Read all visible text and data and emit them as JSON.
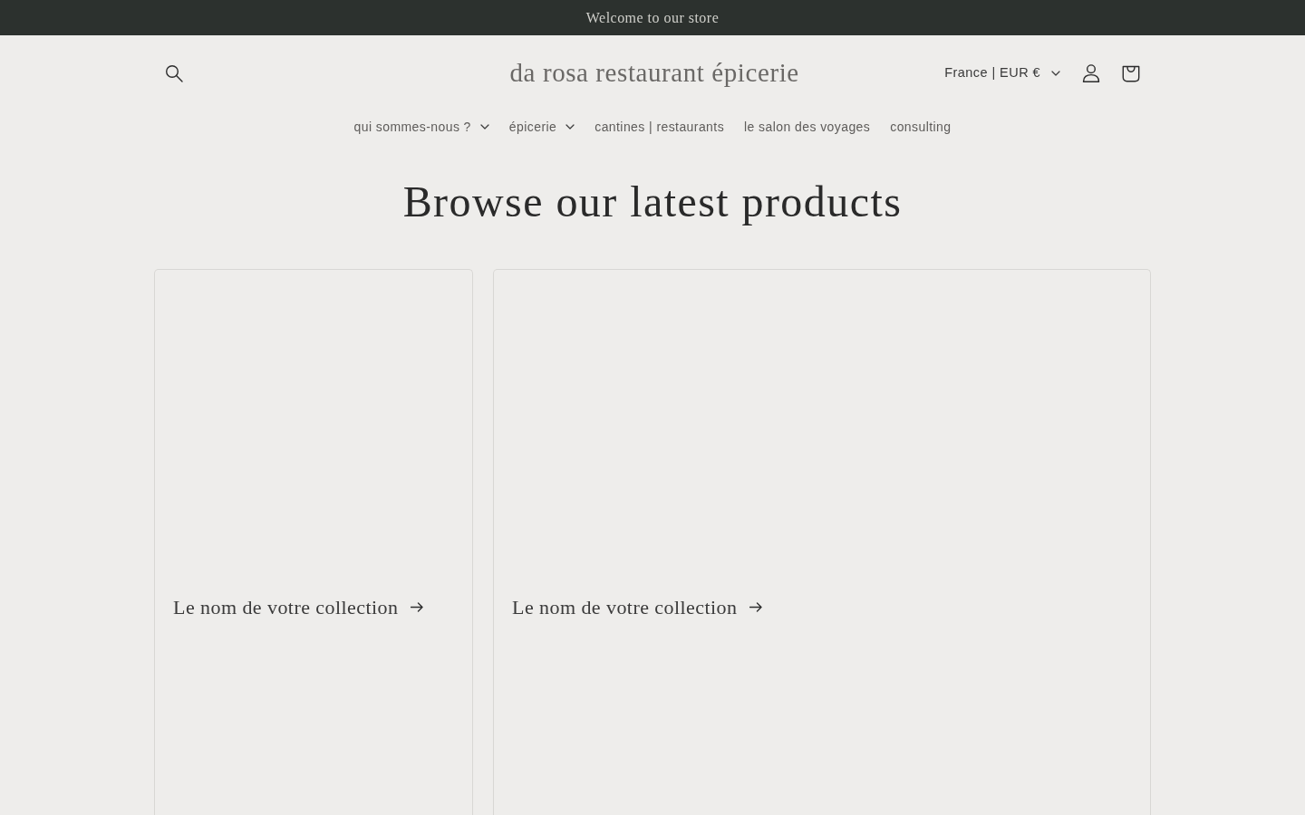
{
  "announcement": {
    "text": "Welcome to our store"
  },
  "header": {
    "logo": "da rosa restaurant épicerie",
    "localization": {
      "label": "France | EUR €"
    }
  },
  "nav": [
    {
      "label": "qui sommes-nous ?",
      "dropdown": true
    },
    {
      "label": "épicerie",
      "dropdown": true
    },
    {
      "label": "cantines | restaurants",
      "dropdown": false
    },
    {
      "label": "le salon des voyages",
      "dropdown": false
    },
    {
      "label": "consulting",
      "dropdown": false
    }
  ],
  "section": {
    "heading": "Browse our latest products"
  },
  "collections": [
    {
      "title": "Le nom de votre collection"
    },
    {
      "title": "Le nom de votre collection"
    }
  ]
}
